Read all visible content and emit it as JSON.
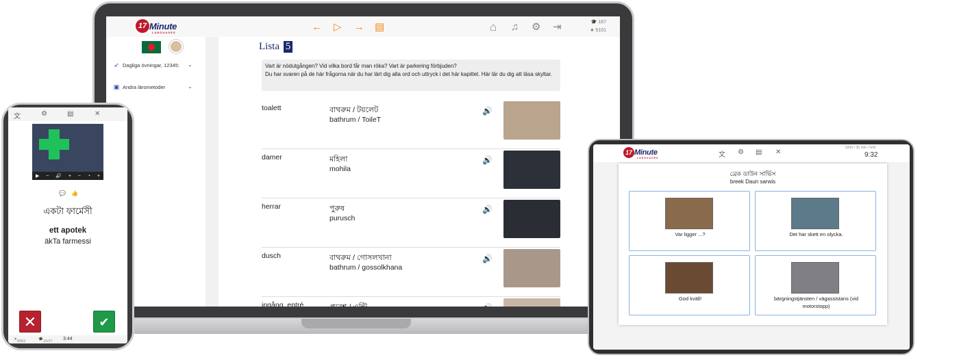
{
  "brand": {
    "number": "17",
    "word": "Minute",
    "sub": "LANGUAGES"
  },
  "laptop": {
    "stats": {
      "hats": "167",
      "stars": "5101"
    },
    "sidebar": {
      "daily_label": "Dagliga övningar, 12345:",
      "other_label": "Andra lärometoder"
    },
    "lista": {
      "label": "Lista",
      "number": "5"
    },
    "info_text_1": "Vart är nödutgången? Vid vilka bord får man röka? Vart är parkering förbjuden?",
    "info_text_2": "Du har svaren på de här frågorna när du har lärt dig alla ord och uttryck i det här kapitlet. Här lär du dig att läsa skyltar.",
    "vocab": [
      {
        "sv": "toalett",
        "bn": "বাথরুম / টয়লেট",
        "tr": "bathrum / ToileT",
        "pic_color": "#b9a48e"
      },
      {
        "sv": "damer",
        "bn": "মহিলা",
        "tr": "mohila",
        "pic_color": "#2c3038"
      },
      {
        "sv": "herrar",
        "bn": "পুরুষ",
        "tr": "purusch",
        "pic_color": "#2a2d33"
      },
      {
        "sv": "dusch",
        "bn": "বাথরুম / গোসলখানা",
        "tr": "bathrum / gossolkhana",
        "pic_color": "#a9988a"
      },
      {
        "sv": "ingång, entré",
        "bn": "প্রবেশ / এন্ট্রি",
        "tr": "",
        "pic_color": "#c8b7a6"
      }
    ]
  },
  "phone": {
    "player": {
      "play": "▶",
      "minus": "−",
      "vol": "🔊",
      "plus": "+",
      "minus2": "−",
      "speed": "◔",
      "plus2": "+"
    },
    "bn_word": "একটা ফার্মেসী",
    "sv_word": "ett apotek",
    "translit": "äkTa farmessi",
    "footer": {
      "stars": "8963",
      "hats": "16/27",
      "time": "3:44"
    }
  },
  "tablet": {
    "stats": "5206 • 35 min • 5/42",
    "time": "9:32",
    "question_bn": "ব্রেক ডাউন সার্ভিস",
    "question_tr": "breek Daun sarwis",
    "options": [
      {
        "label": "Var ligger ...?",
        "color": "#8a6a4c"
      },
      {
        "label": "Det har skett en olycka.",
        "color": "#5d7a8a"
      },
      {
        "label": "God kväll!",
        "color": "#6b4a34"
      },
      {
        "label": "bärgningstjänsten / vägassistans (vid motorstopp)",
        "color": "#7f7f85"
      }
    ]
  },
  "icons": {
    "back": "←",
    "play": "▷",
    "forward": "→",
    "card": "▤",
    "home": "⌂",
    "music": "♫",
    "settings": "⚙",
    "logout": "⇥",
    "speaker": "🔊",
    "chevron": "⌄",
    "rocket": "➶",
    "book": "▣",
    "close": "✕",
    "check": "✔"
  }
}
